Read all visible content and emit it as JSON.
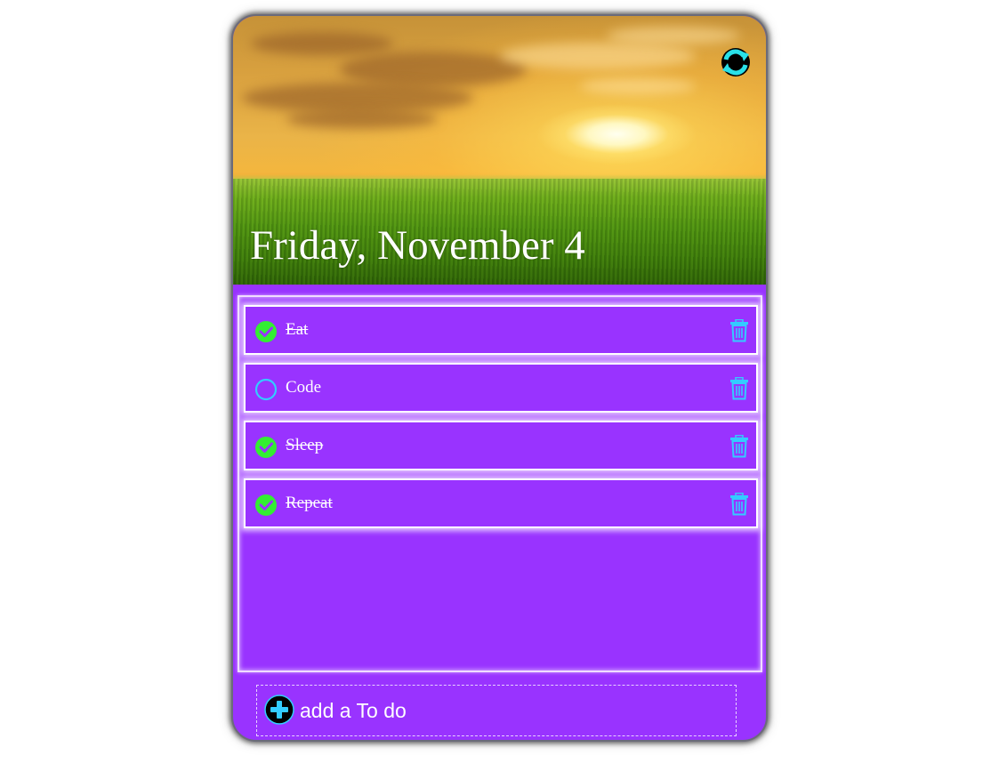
{
  "header": {
    "date_title": "Friday, November 4",
    "refresh_icon": "refresh-icon"
  },
  "todos": [
    {
      "label": "Eat",
      "completed": true
    },
    {
      "label": "Code",
      "completed": false
    },
    {
      "label": "Sleep",
      "completed": true
    },
    {
      "label": "Repeat",
      "completed": true
    }
  ],
  "add_bar": {
    "placeholder": "add a To do",
    "icon": "plus-circle-icon"
  },
  "colors": {
    "card_bg": "#9933ff",
    "check_done": "#33ff33",
    "check_open": "#33ccff",
    "trash": "#33ccff",
    "text": "#ffffff"
  }
}
